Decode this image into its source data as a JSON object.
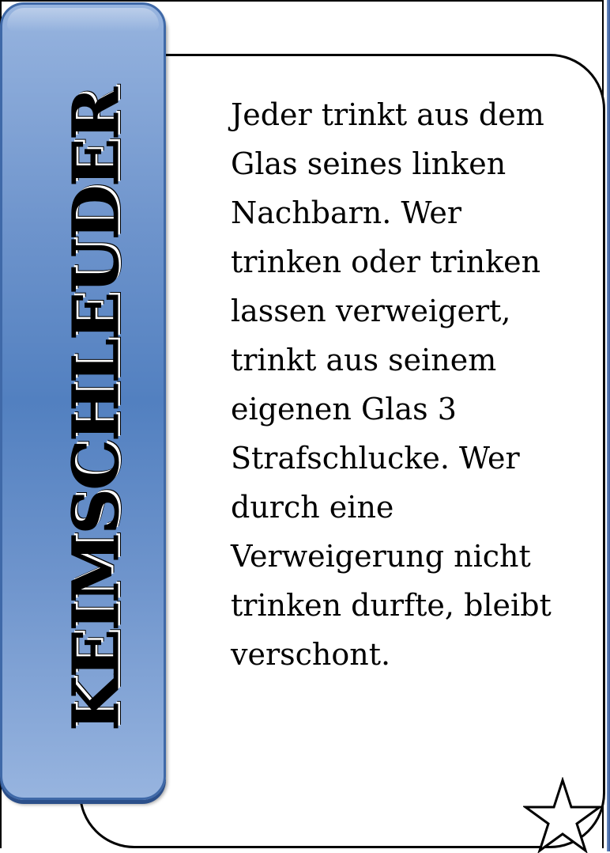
{
  "card": {
    "title": "KEIMSCHLEUDER",
    "text_lines": [
      "Jeder trinkt aus dem",
      "Glas seines linken",
      "Nachbarn. Wer",
      "trinken oder trinken",
      "lassen verweigert,",
      "trinkt aus seinem",
      "eigenen Glas 3",
      "Strafschlucke. Wer",
      "durch eine",
      "Verweigerung nicht",
      "trinken durfte, bleibt",
      "verschont."
    ]
  },
  "icons": {
    "corner": "star-icon"
  },
  "colors": {
    "panel_light": "#97b4df",
    "panel_mid": "#5280c0",
    "panel_border": "#3f69a8",
    "text": "#000000"
  }
}
